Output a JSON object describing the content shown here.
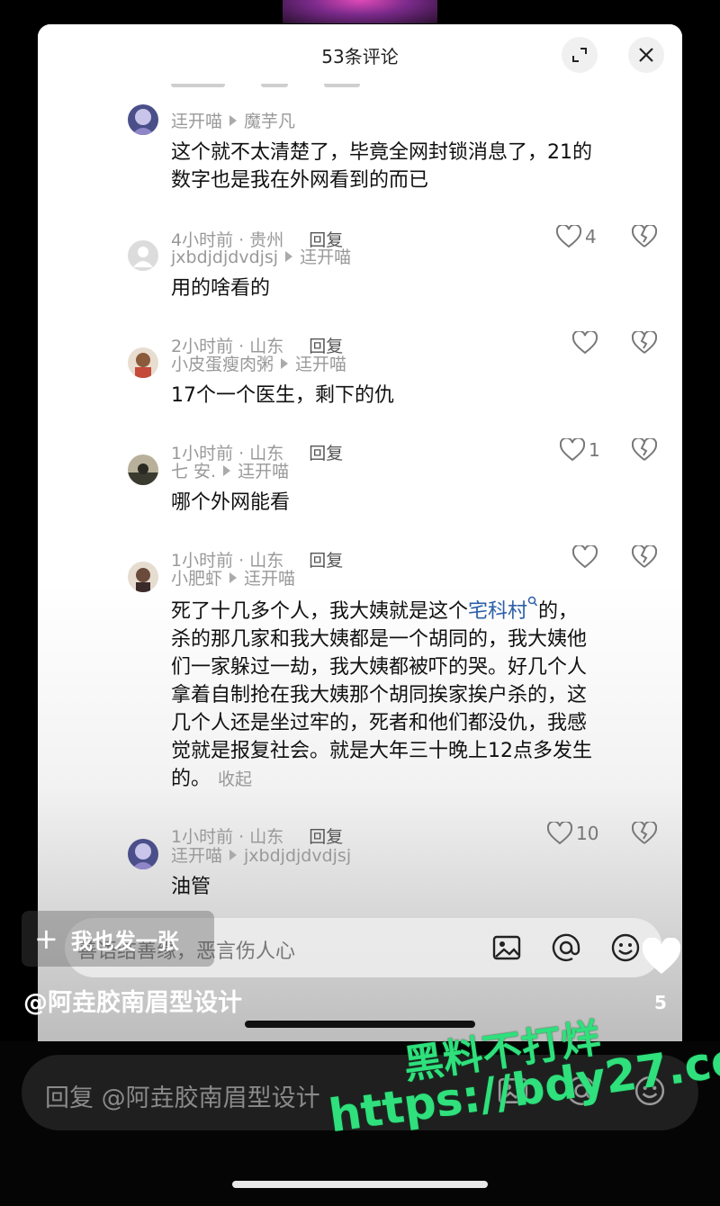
{
  "sheet": {
    "title": "53条评论"
  },
  "comments": [
    {
      "user": "迋开喵",
      "reply_to": "魔芋凡",
      "lines": [
        "这个就不太清楚了，毕竟全网封锁消息了，21的",
        "数字也是我在外网看到的而已"
      ],
      "time_loc": "4小时前 · 贵州",
      "reply": "回复",
      "likes": "4"
    },
    {
      "user": "jxbdjdjdvdjsj",
      "reply_to": "迋开喵",
      "lines": [
        "用的啥看的"
      ],
      "time_loc": "2小时前 · 山东",
      "reply": "回复",
      "likes": ""
    },
    {
      "user": "小皮蛋瘦肉粥",
      "reply_to": "迋开喵",
      "lines": [
        "17个一个医生，剩下的仇"
      ],
      "time_loc": "1小时前 · 山东",
      "reply": "回复",
      "likes": "1"
    },
    {
      "user": "七 安.",
      "reply_to": "迋开喵",
      "lines": [
        "哪个外网能看"
      ],
      "time_loc": "1小时前 · 山东",
      "reply": "回复",
      "likes": ""
    },
    {
      "user": "小肥虾",
      "reply_to": "迋开喵",
      "line1_pre": "死了十几多个人，我大姨就是这个",
      "line1_link": "宅科村",
      "line1_post": "的，",
      "lines_rest": [
        "杀的那几家和我大姨都是一个胡同的，我大姨他",
        "们一家躲过一劫，我大姨都被吓的哭。好几个人",
        "拿着自制抢在我大姨那个胡同挨家挨户杀的，这",
        "几个人还是坐过牢的，死者和他们都没仇，我感",
        "觉就是报复社会。就是大年三十晚上12点多发生"
      ],
      "last_line": "的。",
      "fold": "收起",
      "time_loc": "1小时前 · 山东",
      "reply": "回复",
      "likes": "10"
    },
    {
      "user": "迋开喵",
      "reply_to": "jxbdjdjdvdjsj",
      "lines": [
        "油管"
      ]
    }
  ],
  "comment_input": {
    "placeholder": "善语结善缘，恶言伤人心"
  },
  "post_button": {
    "label": "我也发一张"
  },
  "video": {
    "author": "@阿垚胶南眉型设计",
    "like_count": "5"
  },
  "reply_input": {
    "placeholder": "回复 @阿垚胶南眉型设计"
  },
  "watermark": {
    "line1": "黑料不打烊",
    "line2": "https://bdy27.co"
  }
}
